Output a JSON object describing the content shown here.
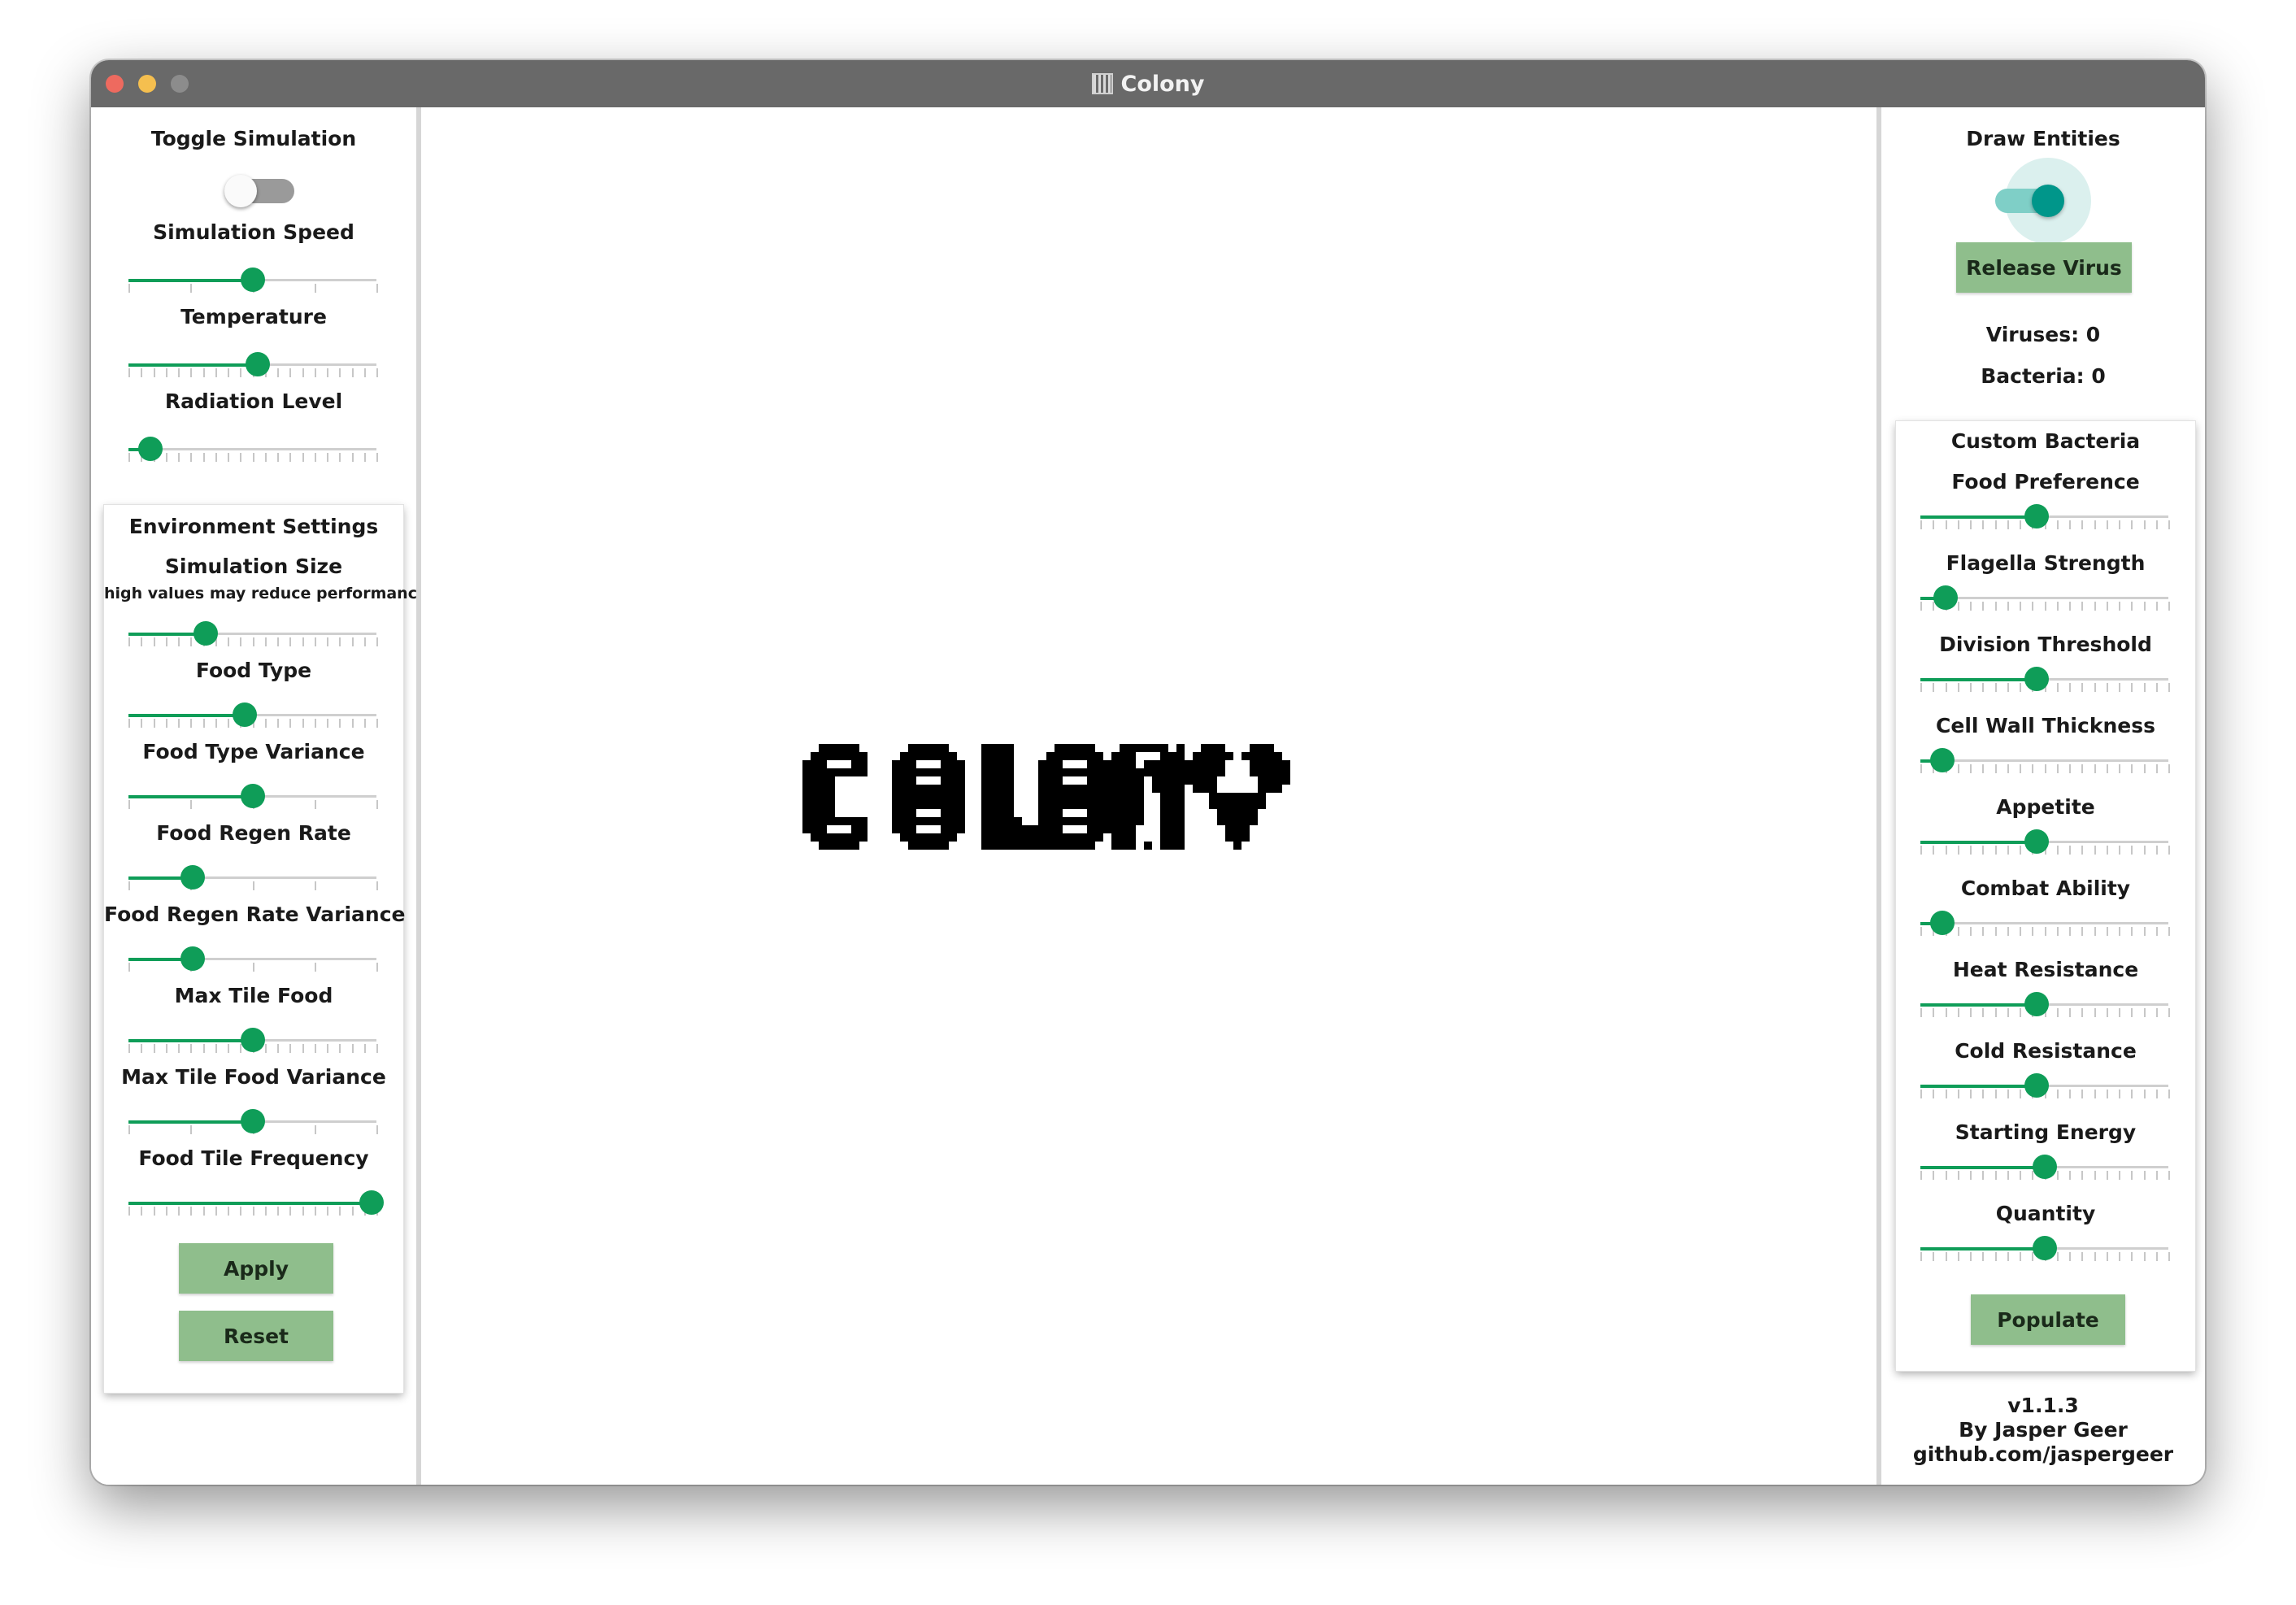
{
  "window": {
    "title": "Colony"
  },
  "left_panel": {
    "toggle_simulation": {
      "label": "Toggle Simulation",
      "on": false
    },
    "sliders": [
      {
        "label": "Simulation Speed",
        "value": 0.5,
        "ticks": 5
      },
      {
        "label": "Temperature",
        "value": 0.52,
        "ticks": 21
      },
      {
        "label": "Radiation Level",
        "value": 0.09,
        "ticks": 21
      }
    ],
    "environment": {
      "title": "Environment Settings",
      "sliders": [
        {
          "label": "Simulation Size",
          "sublabel": "high values may reduce performance",
          "value": 0.31,
          "ticks": 21
        },
        {
          "label": "Food Type",
          "value": 0.47,
          "ticks": 21
        },
        {
          "label": "Food Type Variance",
          "value": 0.5,
          "ticks": 5
        },
        {
          "label": "Food Regen Rate",
          "value": 0.26,
          "ticks": 5
        },
        {
          "label": "Food Regen Rate Variance",
          "value": 0.26,
          "ticks": 5
        },
        {
          "label": "Max Tile Food",
          "value": 0.5,
          "ticks": 21
        },
        {
          "label": "Max Tile Food Variance",
          "value": 0.5,
          "ticks": 5
        },
        {
          "label": "Food Tile Frequency",
          "value": 0.98,
          "ticks": 21
        }
      ],
      "apply_label": "Apply",
      "reset_label": "Reset"
    }
  },
  "canvas": {
    "logo_text": "COLONY"
  },
  "right_panel": {
    "draw_entities": {
      "label": "Draw Entities",
      "on": true
    },
    "release_virus_label": "Release Virus",
    "viruses": "Viruses: 0",
    "bacteria": "Bacteria: 0",
    "custom_bacteria": {
      "title": "Custom Bacteria",
      "sliders": [
        {
          "label": "Food Preference",
          "value": 0.47,
          "ticks": 21
        },
        {
          "label": "Flagella Strength",
          "value": 0.1,
          "ticks": 21
        },
        {
          "label": "Division Threshold",
          "value": 0.47,
          "ticks": 21
        },
        {
          "label": "Cell Wall Thickness",
          "value": 0.09,
          "ticks": 21
        },
        {
          "label": "Appetite",
          "value": 0.47,
          "ticks": 21
        },
        {
          "label": "Combat Ability",
          "value": 0.09,
          "ticks": 21
        },
        {
          "label": "Heat Resistance",
          "value": 0.47,
          "ticks": 21
        },
        {
          "label": "Cold Resistance",
          "value": 0.47,
          "ticks": 21
        },
        {
          "label": "Starting Energy",
          "value": 0.5,
          "ticks": 21
        },
        {
          "label": "Quantity",
          "value": 0.5,
          "ticks": 21
        }
      ],
      "populate_label": "Populate"
    },
    "footer": {
      "version": "v1.1.3",
      "author": "By Jasper Geer",
      "repo": "github.com/jaspergeer"
    }
  },
  "colors": {
    "accent_green": "#0f9d58",
    "button_green": "#8fbe8c",
    "toggle_teal": "#00968a",
    "titlebar": "#696969"
  }
}
